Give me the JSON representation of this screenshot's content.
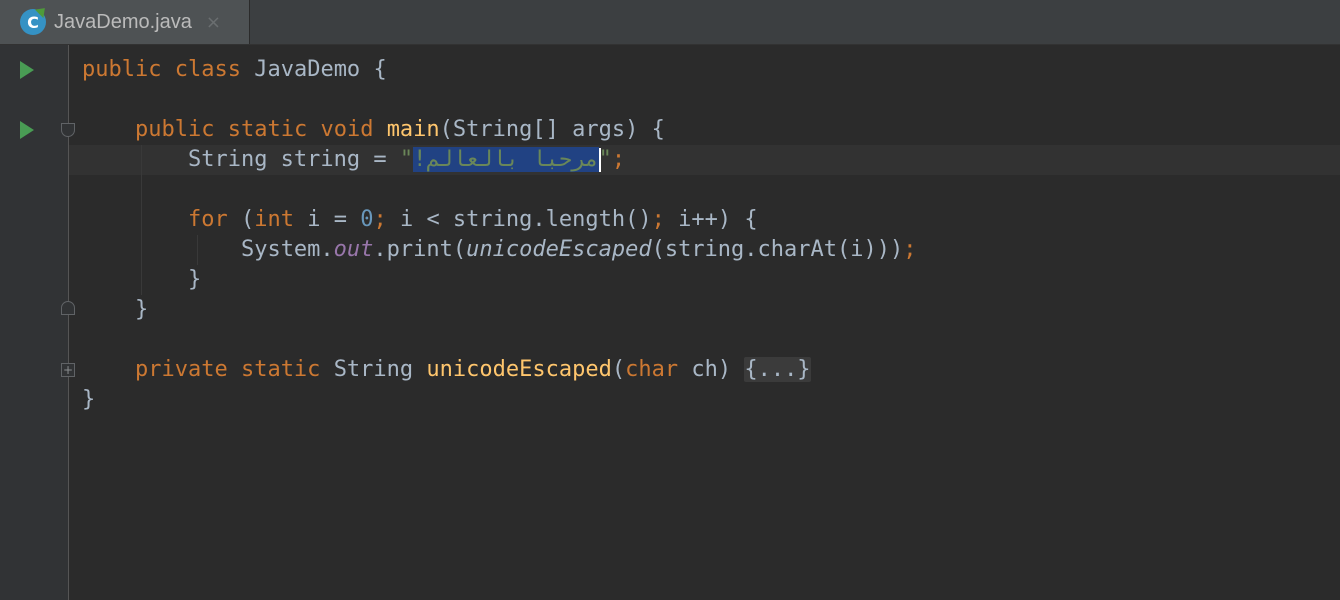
{
  "tab": {
    "icon_letter": "C",
    "title": "JavaDemo.java",
    "close_glyph": "×"
  },
  "code": {
    "l1_kw1": "public",
    "l1_kw2": "class",
    "l1_name": "JavaDemo",
    "l1_brace": "{",
    "l3_kw1": "public",
    "l3_kw2": "static",
    "l3_kw3": "void",
    "l3_fn": "main",
    "l3_params": "(String[] args) {",
    "l4_decl": "String string = ",
    "l4_quote_open": "\"",
    "l4_selected": "مرحبا بالعالم!",
    "l4_quote_close": "\"",
    "l4_semi": ";",
    "l6_for": "for",
    "l6_open": " (",
    "l6_int": "int",
    "l6_i_eq": " i = ",
    "l6_zero": "0",
    "l6_semi1": ";",
    "l6_cond": " i < string.length()",
    "l6_semi2": ";",
    "l6_rest": " i++) {",
    "l7_sys": "System.",
    "l7_out": "out",
    "l7_print": ".print(",
    "l7_static": "unicodeEscaped",
    "l7_args": "(string.charAt(i)))",
    "l7_semi": ";",
    "l8_brace": "}",
    "l9_brace": "}",
    "l11_kw1": "private",
    "l11_kw2": "static",
    "l11_type": "String",
    "l11_fn": "unicodeEscaped",
    "l11_paren_open": "(",
    "l11_char": "char",
    "l11_param": " ch) ",
    "l11_folded": "{...}",
    "l12_brace": "}"
  },
  "gutter": {
    "fold_expand": "+"
  },
  "colors": {
    "keyword": "#cc7832",
    "function": "#ffc66d",
    "string": "#6a8759",
    "number": "#6897bb",
    "field": "#9876aa",
    "text": "#a9b7c6",
    "selection": "#214283",
    "run_marker": "#499c54"
  }
}
